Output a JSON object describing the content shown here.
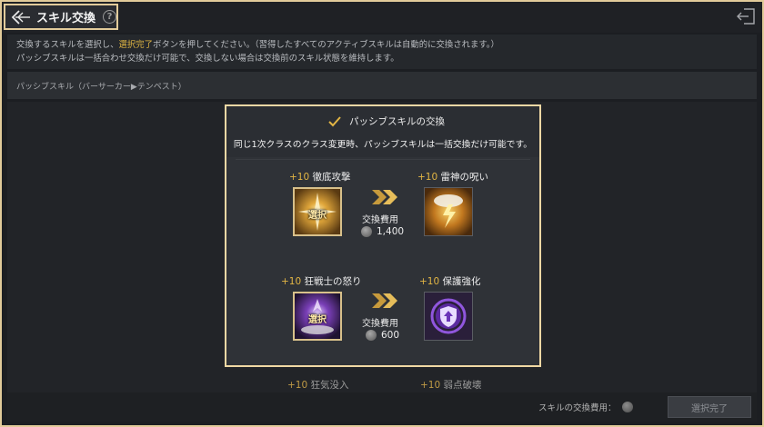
{
  "header": {
    "title": "スキル交換",
    "help_icon": "?"
  },
  "description": {
    "line1_pre": "交換するスキルを選択し、",
    "line1_highlight": "選択完了",
    "line1_post": "ボタンを押してください。（習得したすべてのアクティブスキルは自動的に交換されます。）",
    "line2": "パッシブスキルは一括合わせ交換だけ可能で、交換しない場合は交換前のスキル状態を維持します。"
  },
  "passive_row_label": "パッシブスキル（バーサーカー▶テンペスト）",
  "background_items": [
    {
      "plus": "+10",
      "name": "狂気没入"
    },
    {
      "plus": "+10",
      "name": "弱点破壊"
    }
  ],
  "bottom": {
    "cost_label": "スキルの交換費用：",
    "done_label": "選択完了"
  },
  "modal": {
    "checkbox_label": "パッシブスキルの交換",
    "checked": true,
    "subtitle": "同じ1次クラスのクラス変更時、パッシブスキルは一括交換だけ可能です。",
    "pairs": [
      {
        "from_plus": "+10",
        "from_name": "徹底攻撃",
        "from_selected_label": "選択",
        "to_plus": "+10",
        "to_name": "雷神の呪い",
        "cost_title": "交換費用",
        "cost_value": "1,400"
      },
      {
        "from_plus": "+10",
        "from_name": "狂戦士の怒り",
        "from_selected_label": "選択",
        "to_plus": "+10",
        "to_name": "保護強化",
        "cost_title": "交換費用",
        "cost_value": "600"
      }
    ]
  },
  "colors": {
    "accent_gold": "#e2b544",
    "frame": "#e2cb9a",
    "highlight_text": "#e0b643"
  }
}
